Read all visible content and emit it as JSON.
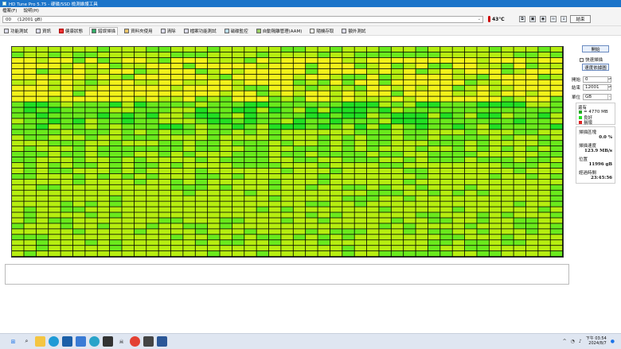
{
  "titlebar": {
    "title": "HD Tune Pro 5.75 - 硬碟/SSD 檢測維護工具"
  },
  "menu": {
    "items": [
      "檔案(F)",
      "說明(H)"
    ]
  },
  "drive": {
    "prefix": "00",
    "size": "(12001 gB)",
    "temperature": "43℃",
    "exit_label": "結束"
  },
  "toolbar_icons": [
    "copy-icon",
    "save-icon",
    "camera-icon",
    "link-icon",
    "download-icon"
  ],
  "tabs": [
    {
      "label": "功能測試",
      "icon": "benchmark-icon"
    },
    {
      "label": "資訊",
      "icon": "info-icon"
    },
    {
      "label": "健康狀態",
      "icon": "health-icon"
    },
    {
      "label": "錯誤掃描",
      "icon": "error-scan-icon",
      "active": true
    },
    {
      "label": "資料夾使用",
      "icon": "folder-usage-icon"
    },
    {
      "label": "清除",
      "icon": "erase-icon"
    },
    {
      "label": "檔案功能測試",
      "icon": "file-benchmark-icon"
    },
    {
      "label": "磁碟監控",
      "icon": "disk-monitor-icon"
    },
    {
      "label": "自動隔離管理(AAM)",
      "icon": "aam-icon"
    },
    {
      "label": "隨機存取",
      "icon": "random-access-icon"
    },
    {
      "label": "額外測試",
      "icon": "extra-tests-icon"
    }
  ],
  "scan_grid": {
    "rows": 38,
    "cols": 45,
    "colors": {
      "green": "#22e022",
      "green_light": "#6aea1c",
      "yellow_green": "#b6ee10",
      "yellow": "#f2f21a"
    }
  },
  "side": {
    "start_label": "開始",
    "quick_scan_label": "快速掃描",
    "speed_map_label": "速度依據圖",
    "start_field_label": "開始",
    "start_value": "0",
    "end_field_label": "結束",
    "end_value": "12001",
    "unit_label": "單位",
    "unit_value": "GB",
    "legend_title": "還有",
    "legend": [
      {
        "label": "= 4770 MB",
        "color": "#22aa22"
      },
      {
        "label": "良好",
        "color": "#22e022"
      },
      {
        "label": "損壞",
        "color": "#dd2222"
      }
    ],
    "stats": [
      {
        "label": "掃描區塊",
        "value": "0.0 %"
      },
      {
        "label": "掃描速度",
        "value": "123.9 MB/s"
      },
      {
        "label": "位置",
        "value": "11996 gB"
      },
      {
        "label": "經過時間",
        "value": "23:45:56"
      }
    ]
  },
  "taskbar": {
    "apps": [
      "windows-start-icon",
      "search-icon",
      "file-explorer-icon",
      "edge-icon",
      "meet-icon",
      "mail-icon",
      "edge-alt-icon",
      "store-icon",
      "alien-icon",
      "chrome-icon",
      "hdtune-icon",
      "task-manager-icon"
    ],
    "time": "下午 03:54",
    "date": "2024/8/7"
  }
}
